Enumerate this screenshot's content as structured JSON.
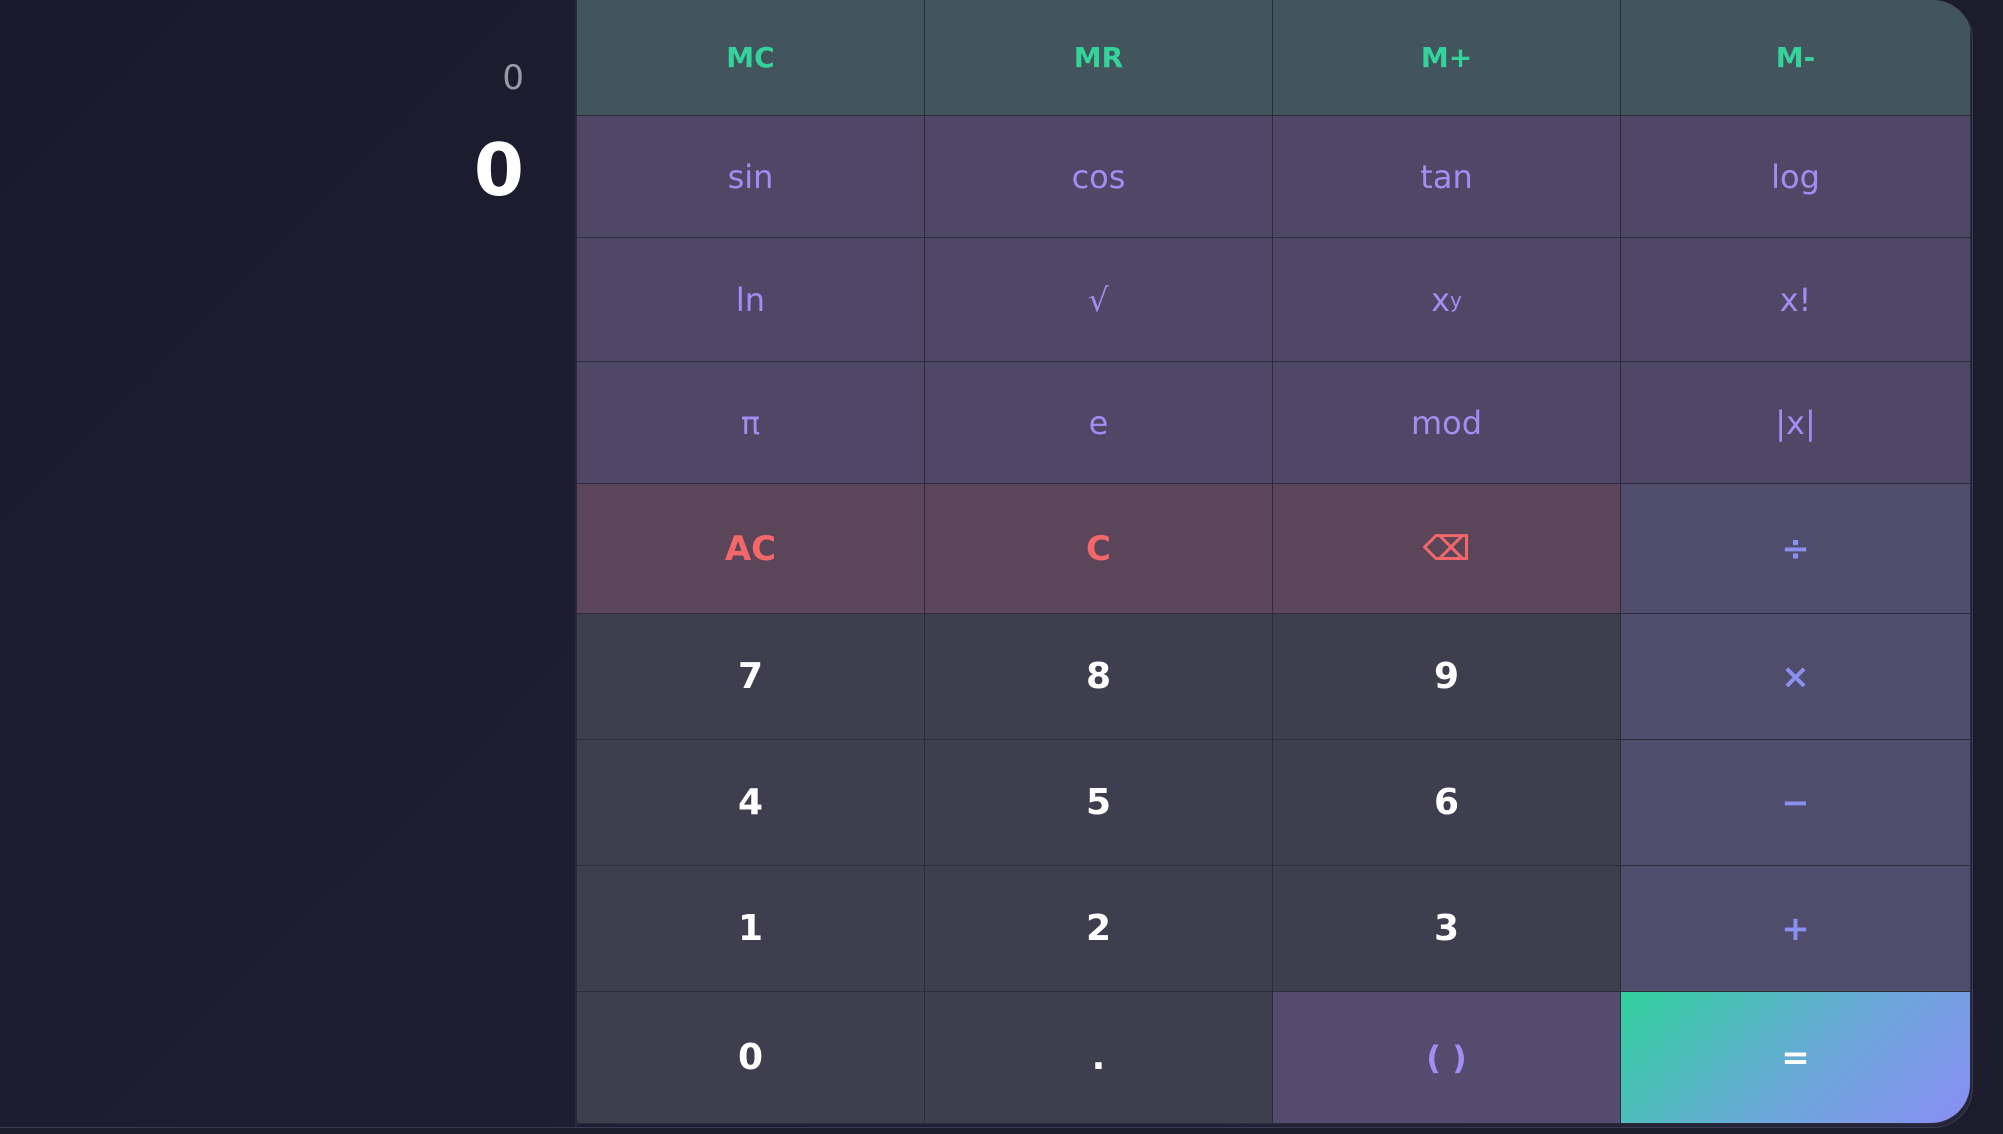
{
  "display": {
    "expression": "0",
    "result": "0"
  },
  "keys": {
    "mc": "MC",
    "mr": "MR",
    "m_plus": "M+",
    "m_minus": "M-",
    "sin": "sin",
    "cos": "cos",
    "tan": "tan",
    "log": "log",
    "ln": "ln",
    "sqrt": "√",
    "power_base": "x",
    "power_exp": "y",
    "factorial": "x!",
    "pi": "π",
    "e": "e",
    "mod": "mod",
    "abs": "|x|",
    "ac": "AC",
    "c": "C",
    "backspace": "⌫",
    "divide": "÷",
    "seven": "7",
    "eight": "8",
    "nine": "9",
    "multiply": "×",
    "four": "4",
    "five": "5",
    "six": "6",
    "minus": "−",
    "one": "1",
    "two": "2",
    "three": "3",
    "plus": "+",
    "zero": "0",
    "dot": ".",
    "parens": "( )",
    "equals": "="
  },
  "colors": {
    "memory": "#34d39a",
    "scientific": "#a48cf2",
    "clear": "#f2686a",
    "operator": "#8a90f0",
    "equals_gradient_start": "#30d19c",
    "equals_gradient_end": "#8a8ef4"
  }
}
